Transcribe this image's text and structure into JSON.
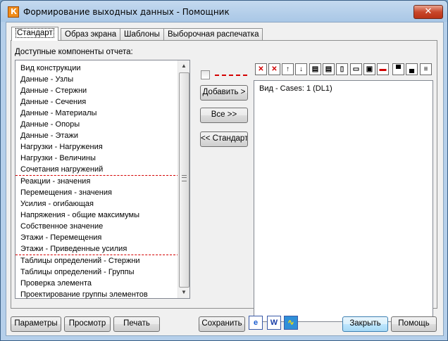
{
  "window": {
    "title": "Формирование выходных данных - Помощник",
    "close_symbol": "✕"
  },
  "tabs": [
    "Стандарт",
    "Образ экрана",
    "Шаблоны",
    "Выборочная распечатка"
  ],
  "available_label": "Доступные компоненты отчета:",
  "available_items": [
    "Вид конструкции",
    "Данные - Узлы",
    "Данные - Стержни",
    "Данные - Сечения",
    "Данные - Материалы",
    "Данные - Опоры",
    "Данные - Этажи",
    "Нагрузки - Нагружения",
    "Нагрузки - Величины",
    "Сочетания нагружений",
    "Реакции - значения",
    "Перемещения - значения",
    "Усилия - огибающая",
    "Напряжения - общие максимумы",
    "Собственное значение",
    "Этажи - Перемещения",
    "Этажи - Приведенные усилия",
    "Таблицы определений - Стержни",
    "Таблицы определений - Группы",
    "Проверка элемента",
    "Проектирование группы элементов"
  ],
  "middle_buttons": {
    "add": "Добавить >",
    "all": "Все >>",
    "standard": "<< Стандарт"
  },
  "selected_items": [
    "Вид - Cases: 1 (DL1)"
  ],
  "toolbar_icons": [
    "delete-icon",
    "delete-all-icon",
    "move-up-icon",
    "move-down-icon",
    "print-icon",
    "print-setup-icon",
    "print-preview-icon",
    "page-setup-icon",
    "printer-icon",
    "edit-icon",
    "header-icon",
    "footer-icon",
    "page-icon"
  ],
  "bottom_buttons": {
    "params": "Параметры",
    "preview": "Просмотр",
    "print": "Печать",
    "save": "Сохранить",
    "close": "Закрыть",
    "help": "Помощь"
  },
  "bottom_icons": [
    "internet-explorer-icon",
    "word-icon",
    "chart-icon"
  ],
  "colors": {
    "separator": "#d40000",
    "accent": "#3c7fb1"
  }
}
